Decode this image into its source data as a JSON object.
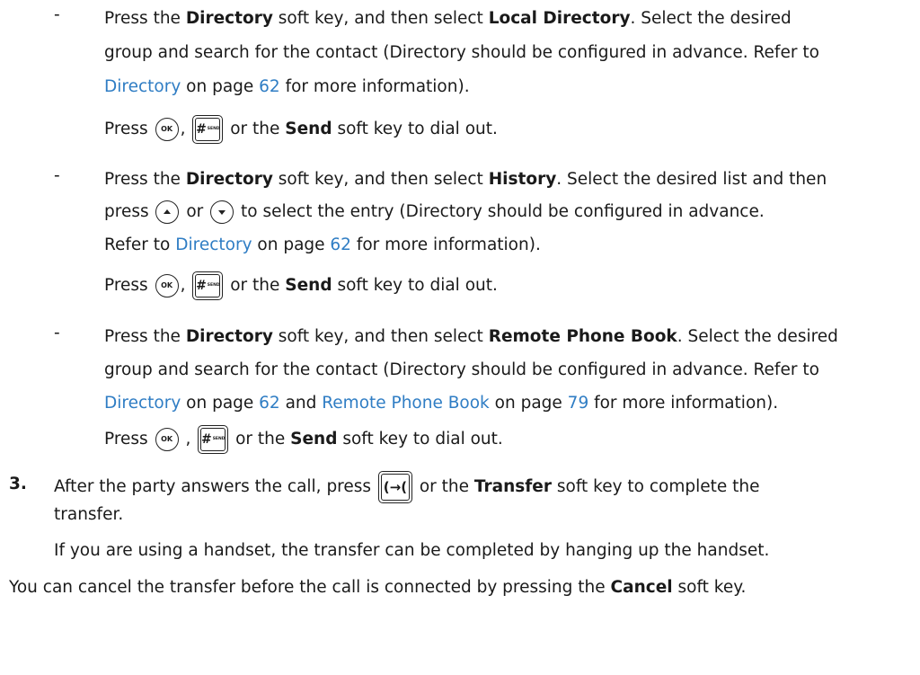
{
  "bullet": "-",
  "k_ok": "OK",
  "k_hash": "#",
  "k_send": "SEND",
  "k_transfer": "(→(",
  "b1": {
    "l1_a": "Press the ",
    "l1_b": "Directory",
    "l1_c": " soft key, and then select ",
    "l1_d": "Local Directory",
    "l1_e": ". Select the desired",
    "l2": "group and search for the contact (Directory should be configured in advance. Refer to",
    "l3_link1": "Directory",
    "l3_b": " on page ",
    "l3_link2": "62",
    "l3_c": " for more information).",
    "p_a": "Press ",
    "p_b": ", ",
    "p_c": " or the ",
    "p_d": "Send",
    "p_e": " soft key to dial out."
  },
  "b2": {
    "l1_a": "Press the ",
    "l1_b": "Directory",
    "l1_c": " soft key, and then select ",
    "l1_d": "History",
    "l1_e": ". Select the desired list and then",
    "l2_a": "press ",
    "l2_b": " or ",
    "l2_c": " to select the entry (Directory should be configured in advance.",
    "l3_a": "Refer to ",
    "l3_link1": "Directory",
    "l3_b": " on page ",
    "l3_link2": "62",
    "l3_c": " for more information).",
    "p_a": "Press ",
    "p_b": ", ",
    "p_c": " or the ",
    "p_d": "Send",
    "p_e": " soft key to dial out."
  },
  "b3": {
    "l1_a": "Press the ",
    "l1_b": "Directory",
    "l1_c": " soft key, and then select ",
    "l1_d": "Remote Phone Book",
    "l1_e": ". Select the desired",
    "l2": "group and search for the contact (Directory should be configured in advance. Refer to",
    "l3_link1": "Directory",
    "l3_b": " on page ",
    "l3_link2": "62",
    "l3_c": " and ",
    "l3_link3": "Remote Phone Book",
    "l3_d": " on page ",
    "l3_link4": "79",
    "l3_e": " for more information).",
    "p_a": "Press ",
    "p_b": " , ",
    "p_c": " or the ",
    "p_d": "Send",
    "p_e": " soft key to dial out."
  },
  "step3": {
    "num": "3.",
    "l1_a": "After the party answers the call, press ",
    "l1_b": " or the ",
    "l1_c": "Transfer",
    "l1_d": " soft key to complete the",
    "l2": "transfer.",
    "l3": "If you are using a handset, the transfer can be completed by hanging up the handset."
  },
  "footer": {
    "a": "You can cancel the transfer before the call is connected by pressing the ",
    "b": "Cancel",
    "c": " soft key."
  }
}
